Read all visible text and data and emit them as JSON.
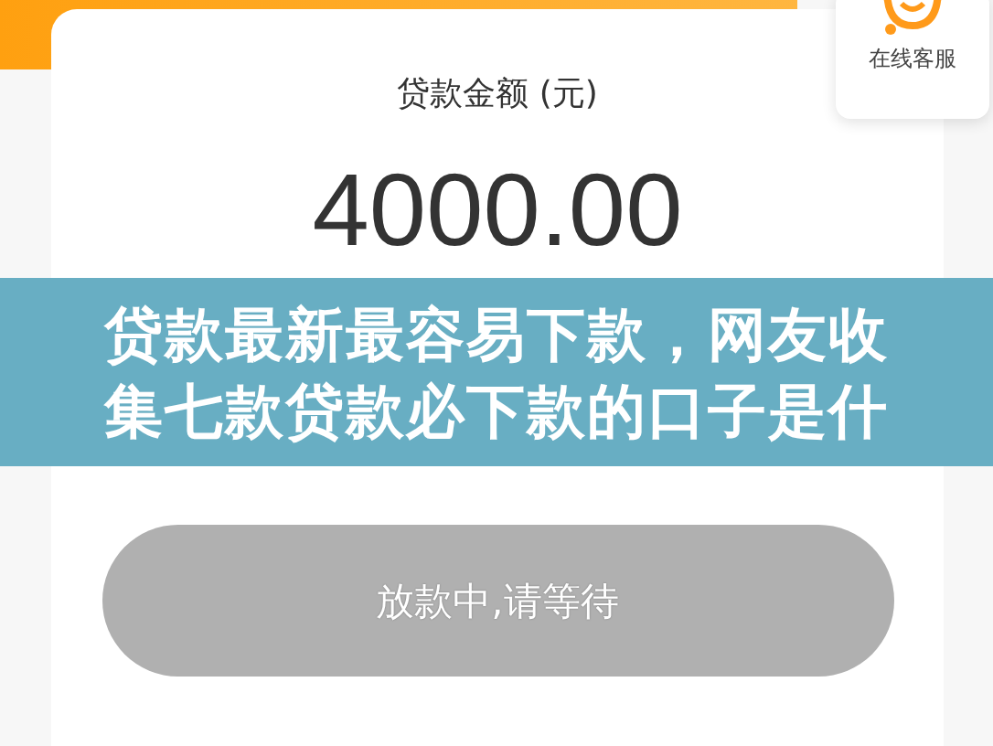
{
  "service_button": {
    "label": "在线客服"
  },
  "loan_card": {
    "label": "贷款金额 (元)",
    "amount": "4000.00"
  },
  "action_button": {
    "label": "放款中,请等待",
    "disabled": true
  },
  "overlay_title": {
    "lines": [
      "贷款最新最容易下款，网友收",
      "集七款贷款必下款的口子是什"
    ]
  }
}
